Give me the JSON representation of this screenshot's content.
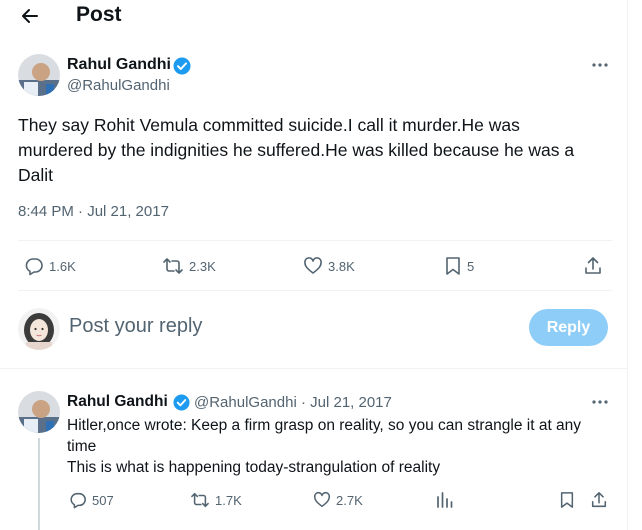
{
  "header": {
    "title": "Post"
  },
  "post": {
    "author_name": "Rahul Gandhi",
    "author_handle": "@RahulGandhi",
    "text_lines": [
      "They say Rohit Vemula committed suicide.I call it murder.He was",
      "murdered by the indignities he suffered.He was killed because he was a",
      "Dalit"
    ],
    "timestamp": "8:44 PM · Jul 21, 2017",
    "stats": {
      "replies": "1.6K",
      "reposts": "2.3K",
      "likes": "3.8K",
      "bookmarks": "5"
    }
  },
  "composer": {
    "placeholder": "Post your reply",
    "reply_label": "Reply"
  },
  "reply": {
    "author_name": "Rahul Gandhi",
    "author_handle": "@RahulGandhi",
    "separator": "·",
    "date": "Jul 21, 2017",
    "text_lines": [
      "Hitler,once wrote: Keep a firm grasp on reality, so you can strangle it at any",
      "time",
      "This is what is happening today-strangulation of reality"
    ],
    "stats": {
      "replies": "507",
      "reposts": "1.7K",
      "likes": "2.7K"
    }
  },
  "colors": {
    "accent": "#1d9bf0",
    "reply_button": "#8ecdf8",
    "muted_text": "#536471",
    "divider": "#eff3f4"
  },
  "icons": {
    "back": "arrow-left-icon",
    "verified": "verified-badge-icon",
    "more": "more-horizontal-icon",
    "reply": "reply-icon",
    "repost": "repost-icon",
    "like": "heart-icon",
    "bookmark": "bookmark-icon",
    "share": "share-icon",
    "views": "views-icon"
  }
}
